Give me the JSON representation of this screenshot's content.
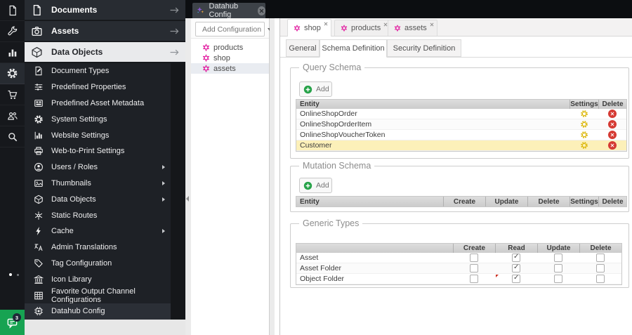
{
  "colors": {
    "accent_green": "#17a352",
    "magenta": "#e0119b",
    "highlight_row": "#fcf0b9",
    "gear_yellow": "#dcb70a",
    "delete_red": "#d53a33",
    "selection_blue": "#e9ecf1"
  },
  "iconbar": {
    "items": [
      {
        "icon": "file-icon"
      },
      {
        "icon": "tools-wrench-icon"
      },
      {
        "icon": "reports-chart-icon"
      },
      {
        "icon": "settings-gear-icon",
        "active": true
      },
      {
        "icon": "ecommerce-cart-icon"
      },
      {
        "icon": "users-icon"
      },
      {
        "icon": "search-icon"
      }
    ],
    "chat": {
      "badge": "3"
    }
  },
  "accordion": {
    "items": [
      {
        "label": "Documents",
        "icon": "document-icon"
      },
      {
        "label": "Assets",
        "icon": "camera-icon"
      },
      {
        "label": "Data Objects",
        "icon": "cube-icon",
        "expanded": true
      }
    ]
  },
  "menu": {
    "items": [
      {
        "label": "Document Types",
        "icon": "document-type-icon"
      },
      {
        "label": "Predefined Properties",
        "icon": "sliders-icon"
      },
      {
        "label": "Predefined Asset Metadata",
        "icon": "metadata-grid-icon"
      },
      {
        "label": "System Settings",
        "icon": "gear-icon"
      },
      {
        "label": "Website Settings",
        "icon": "site-stats-icon"
      },
      {
        "label": "Web-to-Print Settings",
        "icon": "printer-icon"
      },
      {
        "label": "Users / Roles",
        "icon": "user-circle-icon",
        "has_submenu": true
      },
      {
        "label": "Thumbnails",
        "icon": "image-icon",
        "has_submenu": true
      },
      {
        "label": "Data Objects",
        "icon": "cube-icon",
        "has_submenu": true
      },
      {
        "label": "Static Routes",
        "icon": "routes-icon"
      },
      {
        "label": "Cache",
        "icon": "lightning-icon",
        "has_submenu": true
      },
      {
        "label": "Admin Translations",
        "icon": "translate-icon"
      },
      {
        "label": "Tag Configuration",
        "icon": "tag-icon"
      },
      {
        "label": "Icon Library",
        "icon": "bank-icon"
      },
      {
        "label": "Favorite Output Channel Configurations",
        "icon": "grid-icon"
      },
      {
        "label": "Datahub Config",
        "icon": "chip-icon",
        "active": true
      }
    ]
  },
  "datahub_panel": {
    "tab_label": "Datahub Config",
    "add_button_label": "Add Configuration",
    "tree": [
      {
        "label": "products",
        "icon": "hexagram-icon"
      },
      {
        "label": "shop",
        "icon": "hexagram-icon"
      },
      {
        "label": "assets",
        "icon": "hexagram-icon",
        "selected": true
      }
    ]
  },
  "main": {
    "tabs": [
      {
        "label": "shop",
        "icon": "hexagram-icon",
        "active": true
      },
      {
        "label": "products",
        "icon": "hexagram-icon"
      },
      {
        "label": "assets",
        "icon": "hexagram-icon"
      }
    ],
    "subtabs": [
      {
        "label": "General"
      },
      {
        "label": "Schema Definition",
        "active": true
      },
      {
        "label": "Security Definition"
      }
    ],
    "query_schema": {
      "legend": "Query Schema",
      "add_label": "Add",
      "headers": [
        "Entity",
        "Settings",
        "Delete"
      ],
      "rows": [
        {
          "entity": "OnlineShopOrder"
        },
        {
          "entity": "OnlineShopOrderItem"
        },
        {
          "entity": "OnlineShopVoucherToken"
        },
        {
          "entity": "Customer",
          "highlighted": true
        }
      ]
    },
    "mutation_schema": {
      "legend": "Mutation Schema",
      "add_label": "Add",
      "headers": [
        "Entity",
        "Create",
        "Update",
        "Delete",
        "Settings",
        "Delete"
      ],
      "rows": []
    },
    "generic_types": {
      "legend": "Generic Types",
      "headers": [
        "",
        "Create",
        "Read",
        "Update",
        "Delete"
      ],
      "rows": [
        {
          "label": "Asset",
          "create": false,
          "read": true,
          "update": false,
          "delete": false
        },
        {
          "label": "Asset Folder",
          "create": false,
          "read": true,
          "update": false,
          "delete": false
        },
        {
          "label": "Object Folder",
          "create": false,
          "read": true,
          "update": false,
          "delete": false,
          "dirty": true
        }
      ]
    }
  }
}
